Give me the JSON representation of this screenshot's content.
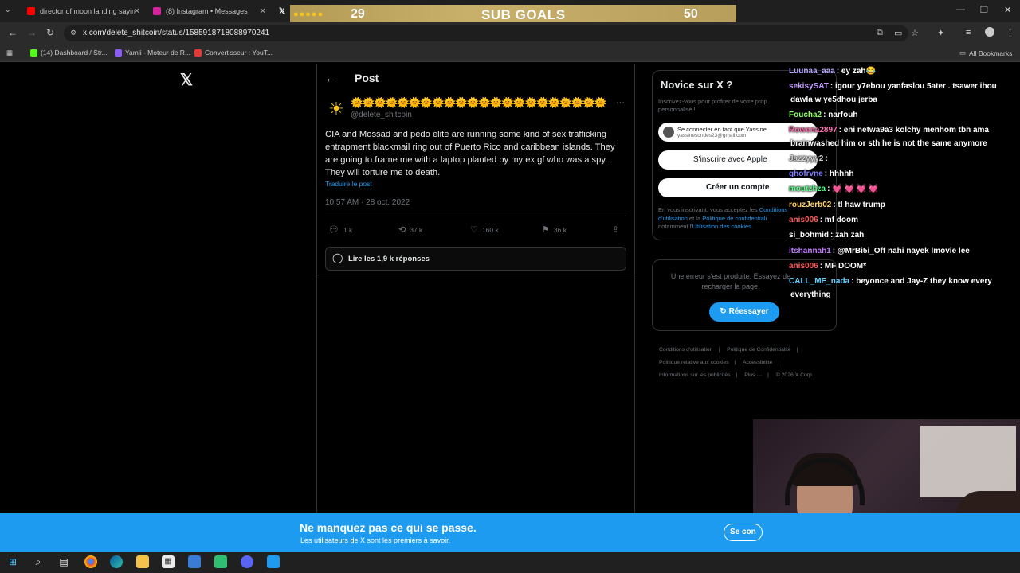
{
  "browser": {
    "tabs": [
      {
        "title": "director of moon landing sayin",
        "color": "#ff0000"
      },
      {
        "title": "(8) Instagram • Messages",
        "color": "#d6249f"
      },
      {
        "title": "",
        "color": "#000000"
      }
    ],
    "url": "x.com/delete_shitcoin/status/1585918718088970241",
    "bookmarks": [
      {
        "label": "(14) Dashboard / Str...",
        "color": "#53fc18"
      },
      {
        "label": "Yamli - Moteur de R...",
        "color": "#8b5cf6"
      },
      {
        "label": "Convertisseur : YouT...",
        "color": "#e53935"
      }
    ],
    "all_bookmarks": "All Bookmarks"
  },
  "subgoal": {
    "current": "29",
    "label": "SUB GOALS",
    "target": "50"
  },
  "x": {
    "logo": "𝕏",
    "post_header": "Post",
    "display_name": "🌞🌞🌞🌞🌞🌞🌞🌞🌞🌞🌞🌞🌞🌞🌞🌞🌞🌞🌞🌞🌞🌞",
    "handle": "@delete_shitcoin",
    "text": "CIA and Mossad and pedo elite are running some kind of sex trafficking entrapment blackmail ring out of Puerto Rico and caribbean islands. They are going to frame me with a laptop planted by my ex gf who was a spy. They will torture me to death.",
    "translate": "Traduire le post",
    "timestamp": "10:57 AM · 28 oct. 2022",
    "actions": {
      "replies": "1 k",
      "reposts": "37 k",
      "likes": "160 k",
      "bookmarks": "36 k"
    },
    "read_replies": "Lire les 1,9 k réponses"
  },
  "sidebar": {
    "title": "Novice sur X ?",
    "subtitle": "Inscrivez-vous pour profiter de votre prop personnalisé !",
    "google_line1": "Se connecter en tant que Yassine",
    "google_line2": "yassinesondes23@gmail.com",
    "apple": "S'inscrire avec Apple",
    "create": "Créer un compte",
    "terms_pre": "En vous inscrivant, vous acceptez les ",
    "terms_link1": "Conditions d'utilisation",
    "terms_mid": " et la ",
    "terms_link2": "Politique de confidentiali",
    "terms_mid2": "notamment l'",
    "terms_link3": "Utilisation des cookies",
    "terms_end": ".",
    "error": "Une erreur s'est produite. Essayez de recharger la page.",
    "retry": "Réessayer",
    "footer": [
      "Conditions d'utilisation",
      "Politique de Confidentialité",
      "Politique relative aux cookies",
      "Accessibilité",
      "Informations sur les publicités",
      "Plus ···",
      "© 2026 X Corp."
    ]
  },
  "chat": [
    {
      "user": "Luunaa_aaa",
      "msg": ": ey zah😂",
      "color": "#b9a7ff"
    },
    {
      "user": "sekisySAT",
      "msg": ": igour y7ebou yanfaslou 5ater . tsawer ihou",
      "color": "#c39bff"
    },
    {
      "user": "",
      "msg": "dawla w ye5dhou jerba",
      "color": "#ffffff"
    },
    {
      "user": "Foucha2",
      "msg": ": narfouh",
      "color": "#8fff6a"
    },
    {
      "user": "Rowena2897",
      "msg": ": eni netwa9a3 kolchy menhom tbh ama",
      "color": "#ff6fb0"
    },
    {
      "user": "",
      "msg": "brainwashed him or sth he is not the same anymore",
      "color": "#ffffff"
    },
    {
      "user": "Jazzyyy2",
      "msg": ":",
      "color": "#d0d0d0"
    },
    {
      "user": "ghofrvne",
      "msg": ": hhhhh",
      "color": "#7d7dff"
    },
    {
      "user": "moutzhza",
      "msg": ": 💓 💓 💓 💓",
      "color": "#5dff8d"
    },
    {
      "user": "rouzJerb02",
      "msg": ": tl haw trump",
      "color": "#ffd36b"
    },
    {
      "user": "anis006",
      "msg": ": mf doom",
      "color": "#ff5a5a"
    },
    {
      "user": "si_bohmid",
      "msg": ": zah zah",
      "color": "#ffffff"
    },
    {
      "user": "itshannah1",
      "msg": ": @MrBi5i_Off nahi nayek lmovie lee",
      "color": "#c17bff"
    },
    {
      "user": "anis006",
      "msg": ": MF DOOM*",
      "color": "#ff5a5a"
    },
    {
      "user": "CALL_ME_nada",
      "msg": ": beyonce and Jay-Z they know every",
      "color": "#62d0ff"
    },
    {
      "user": "",
      "msg": "everything",
      "color": "#ffffff"
    }
  ],
  "banner": {
    "title": "Ne manquez pas ce qui se passe.",
    "subtitle": "Les utilisateurs de X sont les premiers à savoir.",
    "button": "Se con"
  },
  "colors": {
    "accent": "#1d9bf0",
    "bg": "#000000",
    "border": "#2f3336"
  }
}
